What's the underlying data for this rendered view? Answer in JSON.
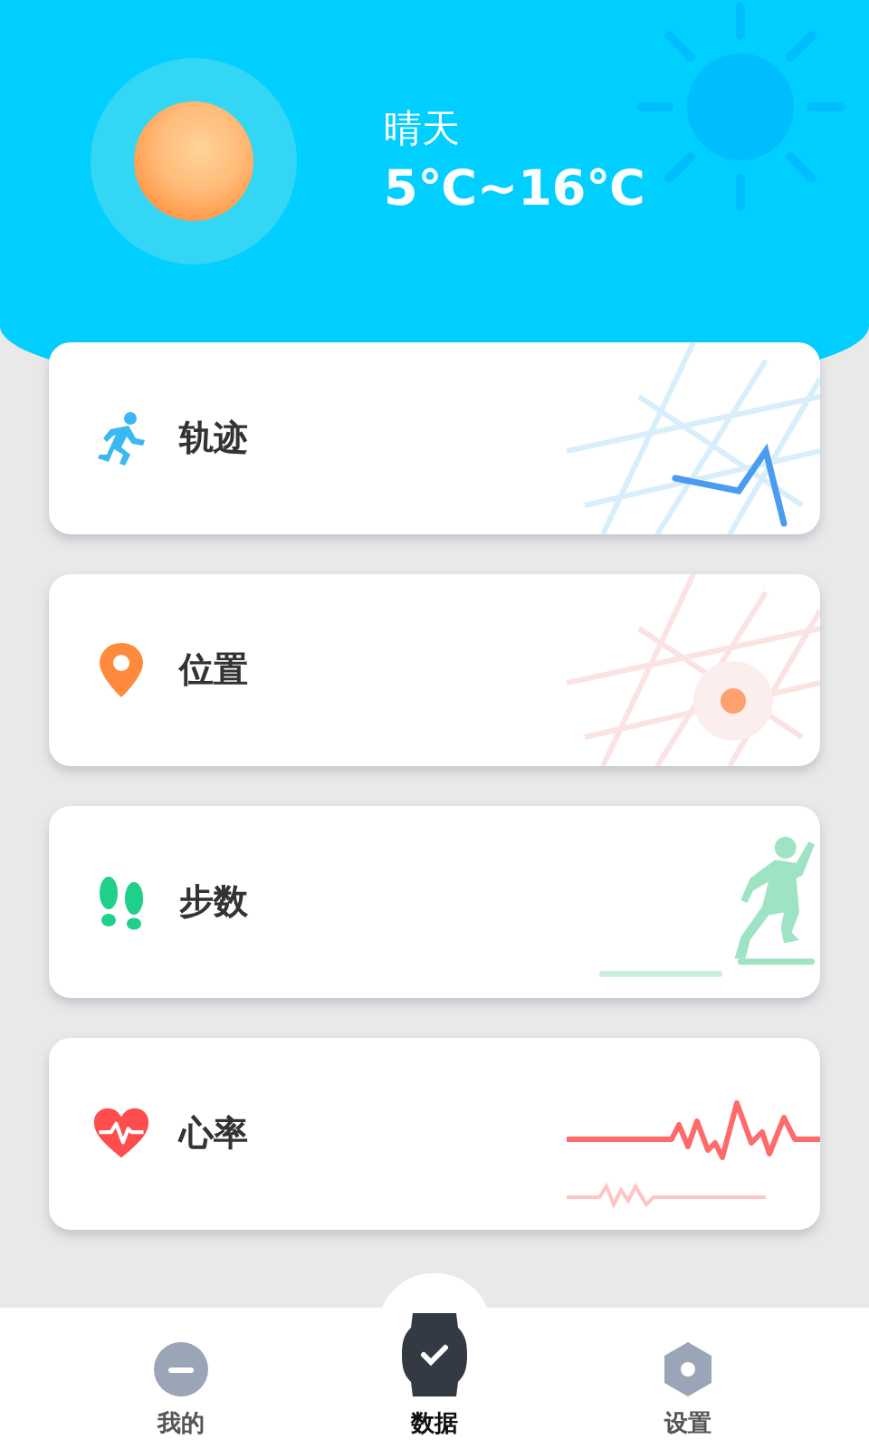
{
  "weather": {
    "condition": "晴天",
    "temperature": "5℃~16℃"
  },
  "cards": [
    {
      "kind": "track",
      "label": "轨迹"
    },
    {
      "kind": "location",
      "label": "位置"
    },
    {
      "kind": "steps",
      "label": "步数"
    },
    {
      "kind": "heart",
      "label": "心率"
    }
  ],
  "nav": [
    {
      "kind": "profile",
      "label": "我的",
      "selected": false
    },
    {
      "kind": "data",
      "label": "数据",
      "selected": true
    },
    {
      "kind": "settings",
      "label": "设置",
      "selected": false
    }
  ]
}
